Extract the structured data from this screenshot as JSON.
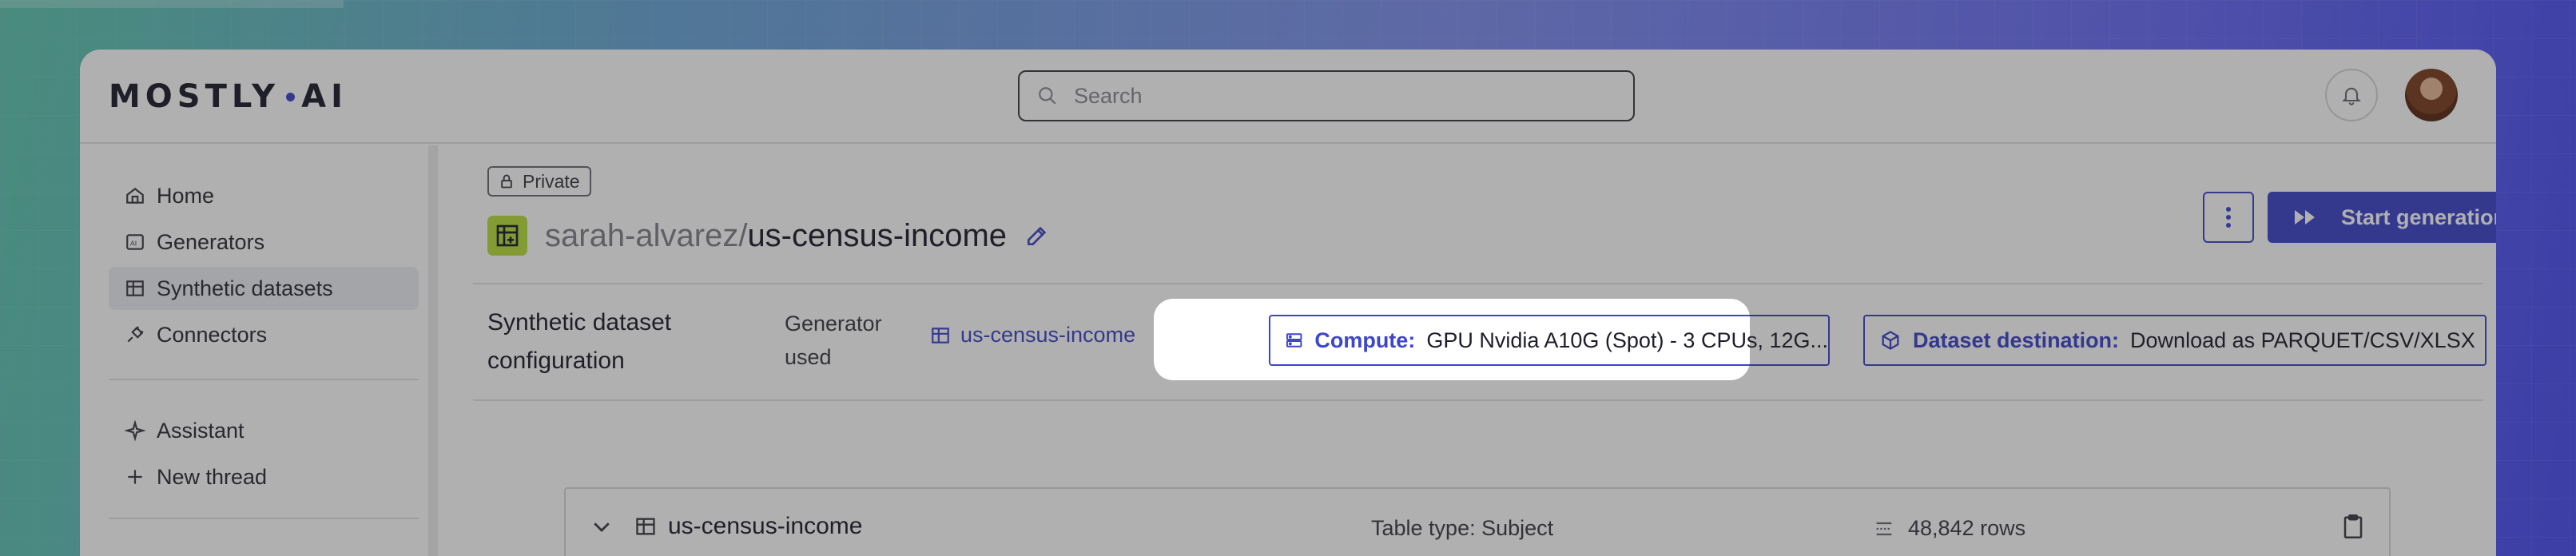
{
  "app": {
    "logo_text_left": "MOSTLY",
    "logo_text_right": "AI"
  },
  "search": {
    "placeholder": "Search"
  },
  "sidebar": {
    "items": [
      {
        "label": "Home",
        "icon": "home-icon"
      },
      {
        "label": "Generators",
        "icon": "ai-chip-icon"
      },
      {
        "label": "Synthetic datasets",
        "icon": "table-icon",
        "active": true
      },
      {
        "label": "Connectors",
        "icon": "plug-icon"
      },
      {
        "label": "Assistant",
        "icon": "sparkle-icon"
      },
      {
        "label": "New thread",
        "icon": "plus-icon"
      }
    ]
  },
  "header": {
    "visibility_badge": "Private",
    "owner": "sarah-alvarez/",
    "dataset_name": "us-census-income",
    "start_button": "Start generation"
  },
  "config": {
    "title": "Synthetic dataset configuration",
    "generator_used_label": "Generator used",
    "generator_name": "us-census-income",
    "compute_label": "Compute:",
    "compute_value": "GPU Nvidia A10G (Spot) - 3 CPUs, 12G...",
    "destination_label": "Dataset destination:",
    "destination_value": "Download as PARQUET/CSV/XLSX"
  },
  "table": {
    "name": "us-census-income",
    "type": "Table type: Subject",
    "rows": "48,842 rows"
  },
  "colors": {
    "accent": "#3e46c9",
    "badge_green": "#b7e03c"
  }
}
